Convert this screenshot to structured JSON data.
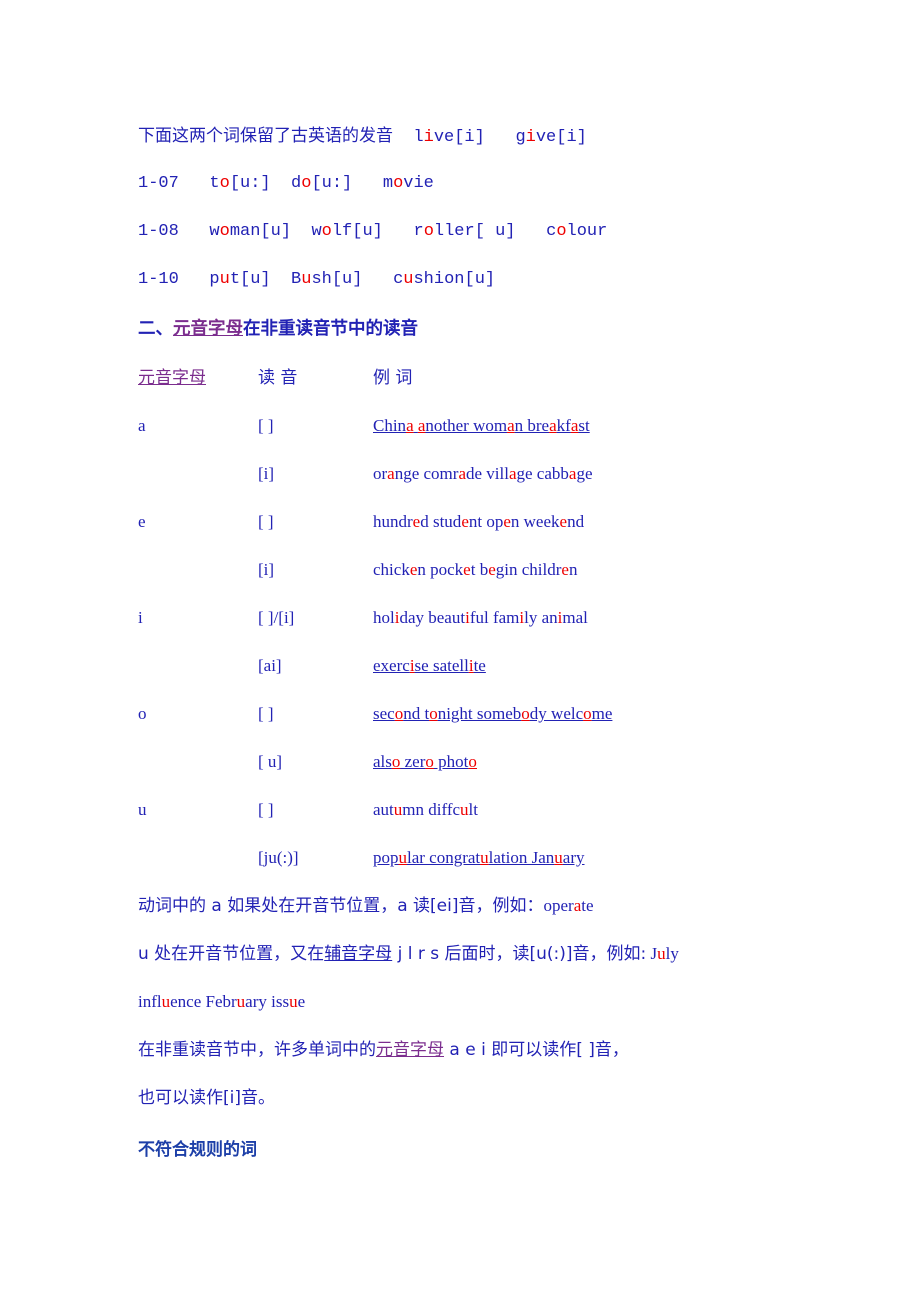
{
  "document": {
    "text_color_blue": "#2222b4",
    "text_color_red": "#ee0000",
    "text_color_purple": "#7b2d8e",
    "text_color_navy": "#1d3fa8"
  },
  "intro": {
    "lead_cn": "下面这两个词保留了古英语的发音",
    "word1_pre": "l",
    "word1_hl": "i",
    "word1_post": "ve[i]",
    "word2_pre": "g",
    "word2_hl": "i",
    "word2_post": "ve[i]"
  },
  "mono_rows": [
    {
      "label": "1-07",
      "items": [
        {
          "pre": "t",
          "hl": "o",
          "post": "[u:]"
        },
        {
          "pre": "d",
          "hl": "o",
          "post": "[u:]"
        },
        {
          "pre": "m",
          "hl": "o",
          "post": "vie"
        }
      ]
    },
    {
      "label": "1-08",
      "items": [
        {
          "pre": "w",
          "hl": "o",
          "post": "man[u]"
        },
        {
          "pre": "w",
          "hl": "o",
          "post": "lf[u]"
        },
        {
          "pre": "r",
          "hl": "o",
          "post": "ller[ u]"
        },
        {
          "pre": "c",
          "hl": "o",
          "post": "lour"
        }
      ]
    },
    {
      "label": "1-10",
      "items": [
        {
          "pre": "p",
          "hl": "u",
          "post": "t[u]"
        },
        {
          "pre": "B",
          "hl": "u",
          "post": "sh[u]"
        },
        {
          "pre": "c",
          "hl": "u",
          "post": "shion[u]"
        }
      ]
    }
  ],
  "section": {
    "number": "二、",
    "highlight": "元音字母",
    "rest": "在非重读音节中的读音"
  },
  "table": {
    "headers": {
      "letter": "元音字母",
      "sound": "读 音",
      "examples": "例 词"
    },
    "rows": [
      {
        "letter": "a",
        "sound": "[ ]",
        "underline": true,
        "words_html": "Chin<r>a</r> <r>a</r>nother wom<r>a</r>n bre<r>a</r>kf<r>a</r>st",
        "words_plain": "China another woman breakfast"
      },
      {
        "letter": "",
        "sound": "[i]",
        "underline": false,
        "words_html": "or<r>a</r>nge comr<r>a</r>de vill<r>a</r>ge cabb<r>a</r>ge",
        "words_plain": "orange comrade village cabbage"
      },
      {
        "letter": "e",
        "sound": "[ ]",
        "underline": false,
        "words_html": "hundr<r>e</r>d stud<r>e</r>nt op<r>e</r>n week<r>e</r>nd",
        "words_plain": "hundred student open weekend"
      },
      {
        "letter": "",
        "sound": "[i]",
        "underline": false,
        "words_html": "chick<r>e</r>n pock<r>e</r>t b<r>e</r>gin childr<r>e</r>n",
        "words_plain": "chicken pocket begin children"
      },
      {
        "letter": "i",
        "sound": "[ ]/[i]",
        "underline": false,
        "words_html": "hol<r>i</r>day beaut<r>i</r>ful fam<r>i</r>ly an<r>i</r>mal",
        "words_plain": "holiday beautiful family animal"
      },
      {
        "letter": "",
        "sound": "[ai]",
        "underline": true,
        "words_html": "exerc<r>i</r>se satell<r>i</r>te",
        "words_plain": "exercise satellite"
      },
      {
        "letter": "o",
        "sound": "[ ]",
        "underline": true,
        "words_html": "sec<r>o</r>nd t<r>o</r>night someb<r>o</r>dy welc<r>o</r>me",
        "words_plain": "second tonight somebody welcome"
      },
      {
        "letter": "",
        "sound": "[ u]",
        "underline": true,
        "words_html": "als<r>o</r> zer<r>o</r> phot<r>o</r>",
        "words_plain": "also zero photo"
      },
      {
        "letter": "u",
        "sound": "[ ]",
        "underline": false,
        "words_html": "aut<r>u</r>mn diffc<r>u</r>lt",
        "words_plain": "autumn diffcult"
      },
      {
        "letter": "",
        "sound": "[ju(:)]",
        "underline": true,
        "words_html": "pop<r>u</r>lar congrat<r>u</r>lation Jan<r>u</r>ary",
        "words_plain": "popular congratulation January"
      }
    ]
  },
  "notes": {
    "p1_a": "动词中的 a 如果处在开音节位置，a 读[ei]音，例如：",
    "p1_word_pre": "oper",
    "p1_word_hl": "a",
    "p1_word_post": "te",
    "p2_a": "u 处在开音节位置，又在",
    "p2_underline": "辅音字母",
    "p2_b": " j l r s 后面时，读[u(:)]音，例如:",
    "p2_word1_pre": "J",
    "p2_word1_hl": "u",
    "p2_word1_post": "ly",
    "p3_w1_pre": "infl",
    "p3_w1_hl": "u",
    "p3_w1_post": "ence",
    "p3_w2_pre": "Febr",
    "p3_w2_hl": "u",
    "p3_w2_post": "ary",
    "p3_w3_pre": "iss",
    "p3_w3_hl": "u",
    "p3_w3_post": "e",
    "p4_a": "在非重读音节中，许多单词中的",
    "p4_purple": "元音字母",
    "p4_b": " a e i 即可以读作[ ]音，",
    "p5": "也可以读作[i]音。"
  },
  "footer_heading": "不符合规则的词"
}
